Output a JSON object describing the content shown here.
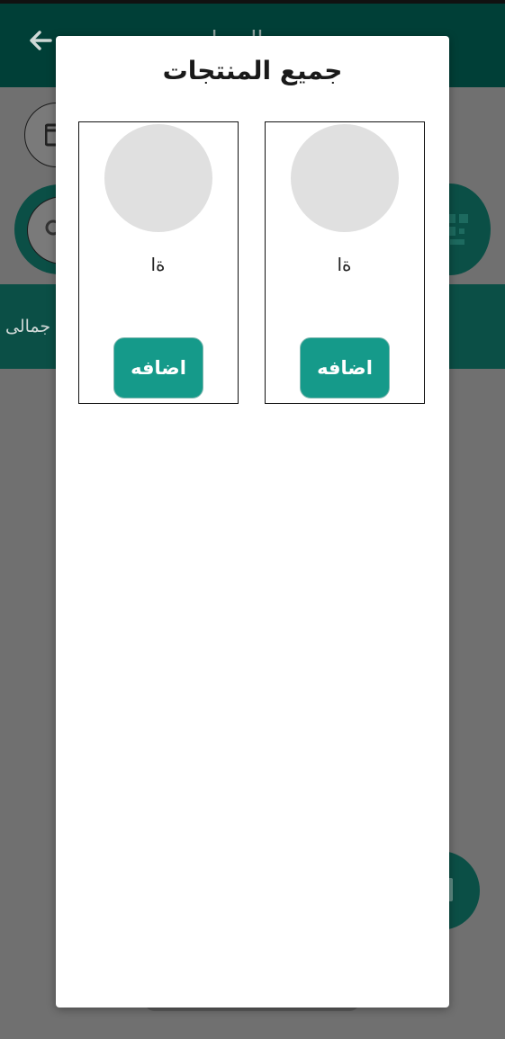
{
  "background_screen": {
    "title": "ال...ات",
    "total_label": "جمالى"
  },
  "dialog": {
    "title": "جميع المنتجات",
    "products": [
      {
        "name": "ةا",
        "add_label": "اضافه"
      },
      {
        "name": "ةا",
        "add_label": "اضافه"
      }
    ]
  },
  "colors": {
    "appbar": "#003f37",
    "accent_button": "#159a8a",
    "overlay": "#707070",
    "image_placeholder": "#e0e0e0"
  },
  "icons": [
    "back-arrow-icon",
    "calendar-icon",
    "search-icon",
    "qr-code-icon",
    "fab-icon"
  ]
}
